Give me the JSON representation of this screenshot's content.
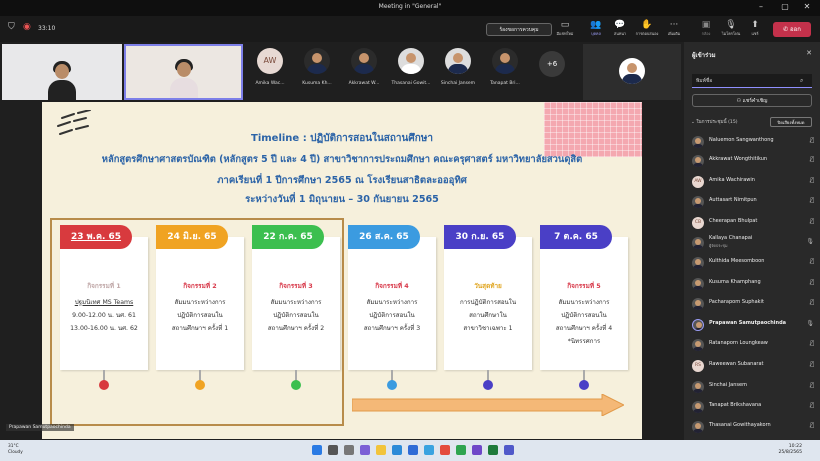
{
  "window": {
    "title": "Meeting in \"General\""
  },
  "toolbar": {
    "time": "33:10",
    "assist": "ร้องขอการควบคุม",
    "buttons": [
      {
        "icon": "chat-icon",
        "label": "มีแชทใหม่"
      },
      {
        "icon": "people-icon",
        "label": "บุคคล"
      },
      {
        "icon": "chat-icon",
        "label": "สนทนา"
      },
      {
        "icon": "hand-icon",
        "label": "การตอบสนอง"
      },
      {
        "icon": "more-icon",
        "label": "เพิ่มเติม"
      },
      {
        "icon": "camera-icon",
        "label": "กล้อง"
      },
      {
        "icon": "mic-icon",
        "label": "ไมโครโฟน"
      },
      {
        "icon": "share-icon",
        "label": "แชร์"
      }
    ],
    "leave": "ออก"
  },
  "participants_strip": [
    {
      "name": "Amika Wac...",
      "initials": "AW"
    },
    {
      "name": "Kusuma Kh..."
    },
    {
      "name": "Akkrawat W..."
    },
    {
      "name": "Thasanai Gowit..."
    },
    {
      "name": "Sinchai Jansem"
    },
    {
      "name": "Tanapat Bri..."
    }
  ],
  "more_count": "+6",
  "slide": {
    "title": "Timeline : ปฏิบัติการสอนในสถานศึกษา",
    "line2": "หลักสูตรศึกษาศาสตรบัณฑิต (หลักสูตร 5 ปี และ 4 ปี) สาขาวิชาการประถมศึกษา คณะครุศาสตร์ มหาวิทยาลัยสวนดุสิต",
    "line3": "ภาคเรียนที่ 1 ปีการศึกษา 2565 ณ โรงเรียนสาธิตละอออุทิศ",
    "line4": "ระหว่างวันที่ 1 มิถุนายน – 30 กันยายน 2565",
    "cards": [
      {
        "date": "23 พ.ค. 65",
        "color": "#d83a3e",
        "activity": "กิจกรรมที่ 1",
        "desc": [
          "ปฐมนิเทศ MS Teams",
          "9.00-12.00 น. นศ. 61",
          "13.00-16.00 น. นศ. 62"
        ]
      },
      {
        "date": "24 มิ.ย. 65",
        "color": "#f0a322",
        "activity": "กิจกรรมที่ 2",
        "desc": [
          "สัมมนาระหว่างการ",
          "ปฏิบัติการสอนใน",
          "สถานศึกษาฯ ครั้งที่ 1"
        ]
      },
      {
        "date": "22 ก.ค. 65",
        "color": "#3cbf4f",
        "activity": "กิจกรรมที่ 3",
        "desc": [
          "สัมมนาระหว่างการ",
          "ปฏิบัติการสอนใน",
          "สถานศึกษาฯ ครั้งที่ 2"
        ]
      },
      {
        "date": "26 ส.ค. 65",
        "color": "#3b9be0",
        "activity": "กิจกรรมที่ 4",
        "desc": [
          "สัมมนาระหว่างการ",
          "ปฏิบัติการสอนใน",
          "สถานศึกษาฯ ครั้งที่ 3"
        ]
      },
      {
        "date": "30 ก.ย. 65",
        "color": "#4a3fc6",
        "activity": "วันสุดท้าย",
        "desc": [
          "การปฏิบัติการสอนใน",
          "สถานศึกษาใน",
          "สาขาวิชาเฉพาะ 1"
        ]
      },
      {
        "date": "7 ต.ค. 65",
        "color": "#4a3fc6",
        "activity": "กิจกรรมที่ 5",
        "desc": [
          "สัมมนาระหว่างการ",
          "ปฏิบัติการสอนใน",
          "สถานศึกษาฯ ครั้งที่ 4",
          "*นิทรรศการ"
        ]
      }
    ]
  },
  "caption_name": "Prapawan Samutpaochinda",
  "sidebar": {
    "title": "ผู้เข้าร่วม",
    "search_placeholder": "พิมพ์ชื่อ",
    "share_invite": "แชร์คำเชิญ",
    "in_meeting": "ในการประชุมนี้ (15)",
    "mute_all": "ปิดเสียงทั้งหมด",
    "people": [
      {
        "name": "Naluemon Sangwanthong"
      },
      {
        "name": "Akkrawat Wongthitikun"
      },
      {
        "name": "Amika Wachirawin",
        "initials": "AW"
      },
      {
        "name": "Auttasart Nimitpun"
      },
      {
        "name": "Cheerapan Bhulpat",
        "initials": "CB"
      },
      {
        "name": "Kallaya Chanapai",
        "sub": "ผู้จัดประชุม"
      },
      {
        "name": "Kulthida Meesomboon"
      },
      {
        "name": "Kusuma Khamphang"
      },
      {
        "name": "Pacharaporn Suphakit"
      },
      {
        "name": "Prapawan Samutpaochinda",
        "bold": true
      },
      {
        "name": "Ratanaporn Loungkeaw"
      },
      {
        "name": "Raweewan Subanarat",
        "initials": "RS"
      },
      {
        "name": "Sinchai Jansem"
      },
      {
        "name": "Tanapat Brikshavana"
      },
      {
        "name": "Thasanai Gowithayakorn"
      }
    ]
  },
  "taskbar": {
    "temp": "31°C",
    "weather": "Cloudy",
    "time": "10:22",
    "date": "25/8/2565"
  }
}
